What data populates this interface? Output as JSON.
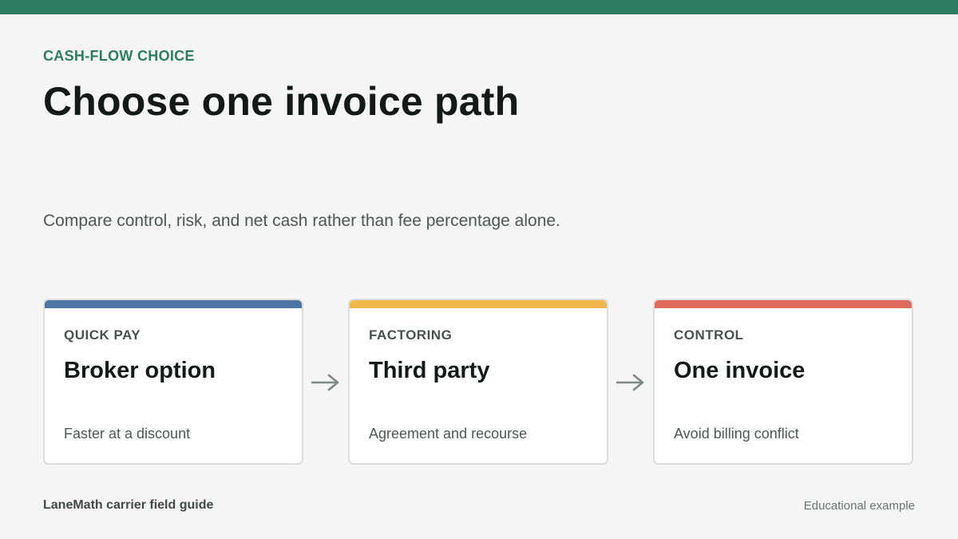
{
  "header": {
    "eyebrow": "CASH-FLOW CHOICE",
    "title": "Choose one invoice path",
    "subtitle": "Compare control, risk, and net cash rather than fee percentage alone."
  },
  "cards": [
    {
      "kicker": "QUICK PAY",
      "heading": "Broker option",
      "description": "Faster at a discount",
      "accent_color": "#4e76a4"
    },
    {
      "kicker": "FACTORING",
      "heading": "Third party",
      "description": "Agreement and recourse",
      "accent_color": "#f0b84a"
    },
    {
      "kicker": "CONTROL",
      "heading": "One invoice",
      "description": "Avoid billing conflict",
      "accent_color": "#e06b5c"
    }
  ],
  "connectors": [
    "arrow-right-icon",
    "arrow-right-icon"
  ],
  "footer": {
    "brand": "LaneMath carrier field guide",
    "note": "Educational example"
  },
  "colors": {
    "brand_green": "#2d7d63",
    "background": "#f4f5f4",
    "arrow": "#7e8784"
  }
}
